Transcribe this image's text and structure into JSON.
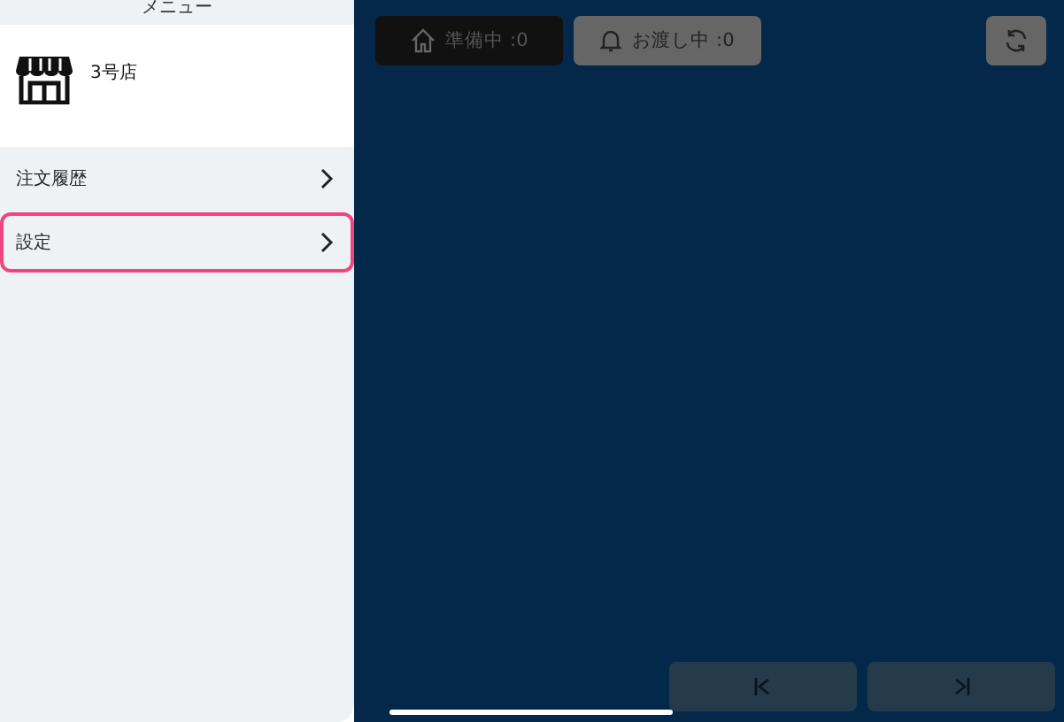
{
  "menu": {
    "title": "メニュー",
    "store": {
      "name": "3号店"
    },
    "items": [
      {
        "label": "注文履歴",
        "selected": false
      },
      {
        "label": "設定",
        "selected": true
      }
    ]
  },
  "tabs": [
    {
      "label": "準備中 :0",
      "kind": "home",
      "selected": true
    },
    {
      "label": "お渡し中 :0",
      "kind": "bell",
      "selected": false
    }
  ]
}
